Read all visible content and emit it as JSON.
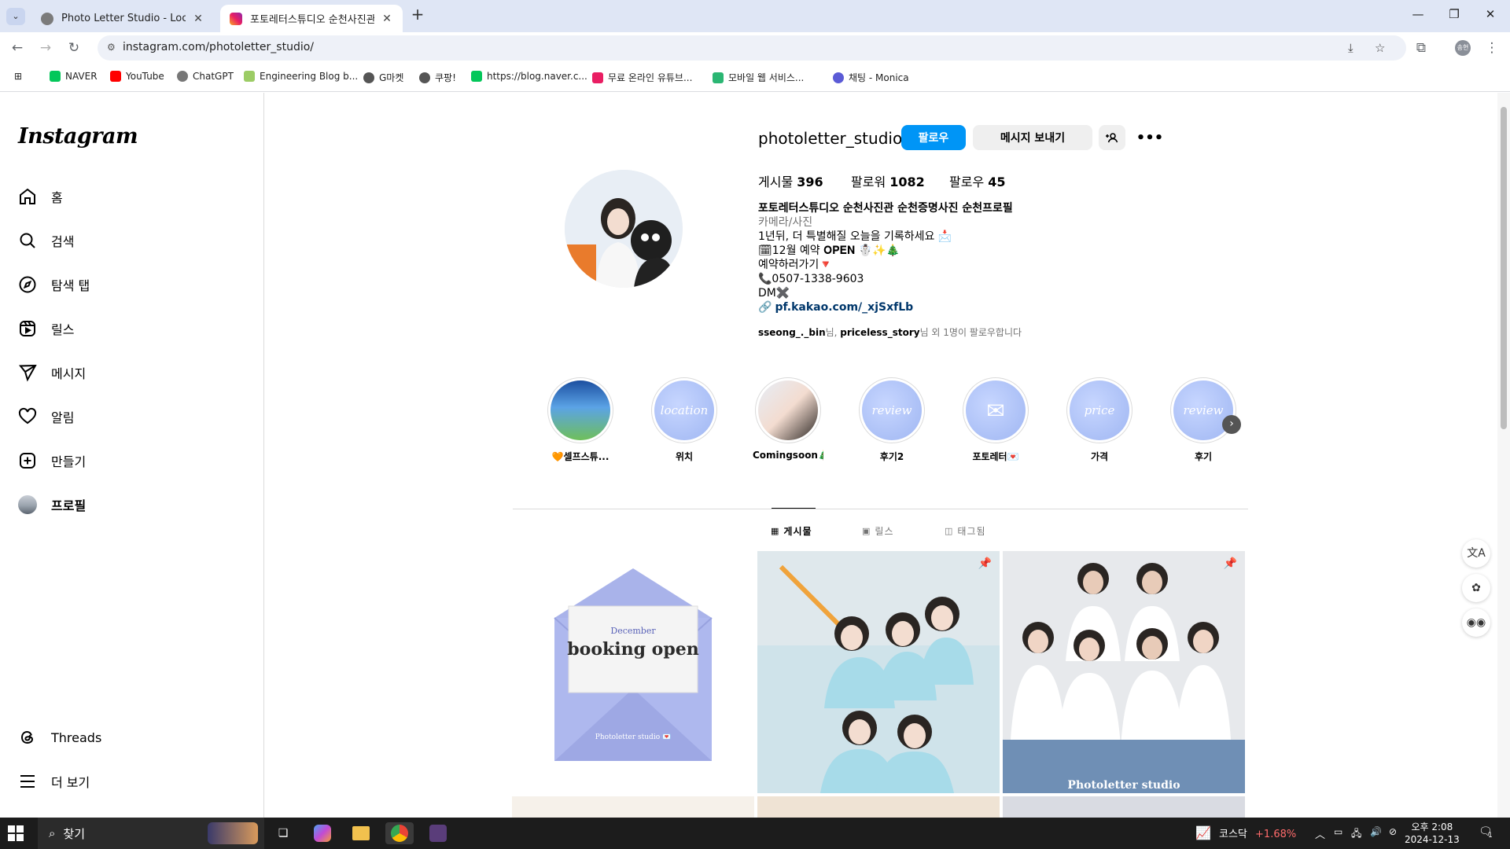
{
  "browser": {
    "tabs": [
      {
        "title": "Photo Letter Studio - Location",
        "active": false
      },
      {
        "title": "포토레터스튜디오 순천사진관",
        "active": true
      }
    ],
    "url": "instagram.com/photoletter_studio/",
    "bookmarks": [
      {
        "label": "NAVER",
        "color": "#03c75a"
      },
      {
        "label": "YouTube",
        "color": "#ff0000"
      },
      {
        "label": "ChatGPT",
        "color": "#444444"
      },
      {
        "label": "Engineering Blog b...",
        "color": "#8a8a8a"
      },
      {
        "label": "G마켓",
        "color": "#555555"
      },
      {
        "label": "쿠팡!",
        "color": "#555555"
      },
      {
        "label": "https://blog.naver.c...",
        "color": "#03c75a"
      },
      {
        "label": "무료 온라인 유튜브...",
        "color": "#e91e63"
      },
      {
        "label": "모바일 웹 서비스...",
        "color": "#2bb673"
      },
      {
        "label": "채팅 - Monica",
        "color": "#5b5bd6"
      }
    ]
  },
  "instagram": {
    "logo": "Instagram",
    "nav": [
      {
        "label": "홈",
        "icon": "home-icon"
      },
      {
        "label": "검색",
        "icon": "search-icon"
      },
      {
        "label": "탐색 탭",
        "icon": "explore-icon"
      },
      {
        "label": "릴스",
        "icon": "reels-icon"
      },
      {
        "label": "메시지",
        "icon": "messages-icon"
      },
      {
        "label": "알림",
        "icon": "heart-icon"
      },
      {
        "label": "만들기",
        "icon": "create-icon"
      },
      {
        "label": "프로필",
        "icon": "profile-avatar"
      }
    ],
    "nav_bottom": [
      {
        "label": "Threads",
        "icon": "threads-icon"
      },
      {
        "label": "더 보기",
        "icon": "menu-icon"
      }
    ],
    "profile": {
      "username": "photoletter_studio",
      "follow_label": "팔로우",
      "message_label": "메시지 보내기",
      "posts_label": "게시물",
      "posts_count": "396",
      "followers_label": "팔로워",
      "followers_count": "1082",
      "following_label": "팔로우",
      "following_count": "45",
      "display_name": "포토레터스튜디오 순천사진관 순천증명사진 순천프로필",
      "category": "카메라/사진",
      "bio_lines": [
        "1년뒤, 더 특별해질 오늘을 기록하세요 📩",
        "🗓12월 예약 𝐎𝐏𝐄𝐍 ☃️✨🎄",
        "예약하러가기🔻",
        "📞0507-1338-9603",
        "DM✖️"
      ],
      "link": "pf.kakao.com/_xjSxfLb",
      "followed_by_user1": "sseong_._bin",
      "followed_by_sep": "님, ",
      "followed_by_user2": "priceless_story",
      "followed_by_rest": "님 외 1명이 팔로우합니다"
    },
    "highlights": [
      {
        "label": "🧡셀프스튜...",
        "text": ""
      },
      {
        "label": "위치",
        "text": "location"
      },
      {
        "label": "Comingsoon🎄",
        "text": ""
      },
      {
        "label": "후기2",
        "text": "review"
      },
      {
        "label": "포토레터💌",
        "text": ""
      },
      {
        "label": "가격",
        "text": "price"
      },
      {
        "label": "후기",
        "text": "review"
      }
    ],
    "tabs": [
      {
        "label": "게시물",
        "active": true
      },
      {
        "label": "릴스",
        "active": false
      },
      {
        "label": "태그됨",
        "active": false
      }
    ],
    "posts": [
      {
        "caption_small": "December",
        "caption_big": "booking open",
        "footer": "Photoletter studio 💌"
      },
      {
        "caption_small": "",
        "caption_big": "",
        "footer": ""
      },
      {
        "caption_small": "",
        "caption_big": "",
        "footer": "Photoletter studio"
      }
    ]
  },
  "taskbar": {
    "search_placeholder": "찾기",
    "stock_name": "코스닥",
    "stock_change": "+1.68%",
    "time": "오후 2:08",
    "date": "2024-12-13",
    "notification_count": "1"
  }
}
